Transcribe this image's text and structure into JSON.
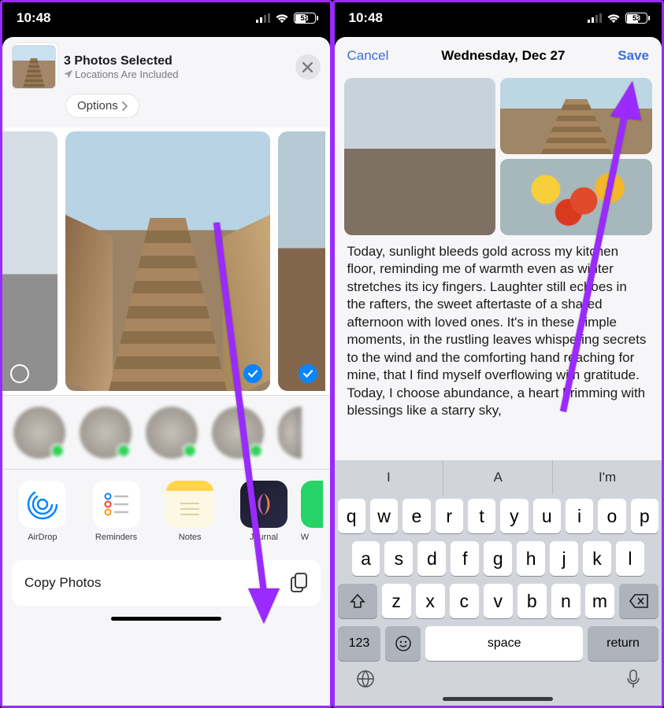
{
  "statusbar": {
    "time": "10:48",
    "battery": "53"
  },
  "shareSheet": {
    "title": "3 Photos Selected",
    "subtitle": "Locations Are Included",
    "optionsLabel": "Options",
    "apps": [
      {
        "name": "AirDrop"
      },
      {
        "name": "Reminders"
      },
      {
        "name": "Notes"
      },
      {
        "name": "Journal"
      },
      {
        "name": "W"
      }
    ],
    "copyAction": "Copy Photos"
  },
  "compose": {
    "cancel": "Cancel",
    "title": "Wednesday, Dec 27",
    "save": "Save",
    "body": "Today, sunlight bleeds gold across my kitchen floor, reminding me of warmth even as winter stretches its icy fingers. Laughter still echoes in the rafters, the sweet aftertaste of a shared afternoon with loved ones. It's in these simple moments, in the rustling leaves whispering secrets to the wind and the comforting hand reaching for mine, that I find myself overflowing with gratitude. Today, I choose abundance, a heart brimming with blessings like a starry sky,"
  },
  "keyboard": {
    "suggestions": [
      "I",
      "A",
      "I'm"
    ],
    "row1": [
      "q",
      "w",
      "e",
      "r",
      "t",
      "y",
      "u",
      "i",
      "o",
      "p"
    ],
    "row2": [
      "a",
      "s",
      "d",
      "f",
      "g",
      "h",
      "j",
      "k",
      "l"
    ],
    "row3": [
      "z",
      "x",
      "c",
      "v",
      "b",
      "n",
      "m"
    ],
    "numKey": "123",
    "space": "space",
    "returnKey": "return"
  },
  "colors": {
    "accent": "#007AFF",
    "arrow": "#9A2AFF"
  }
}
